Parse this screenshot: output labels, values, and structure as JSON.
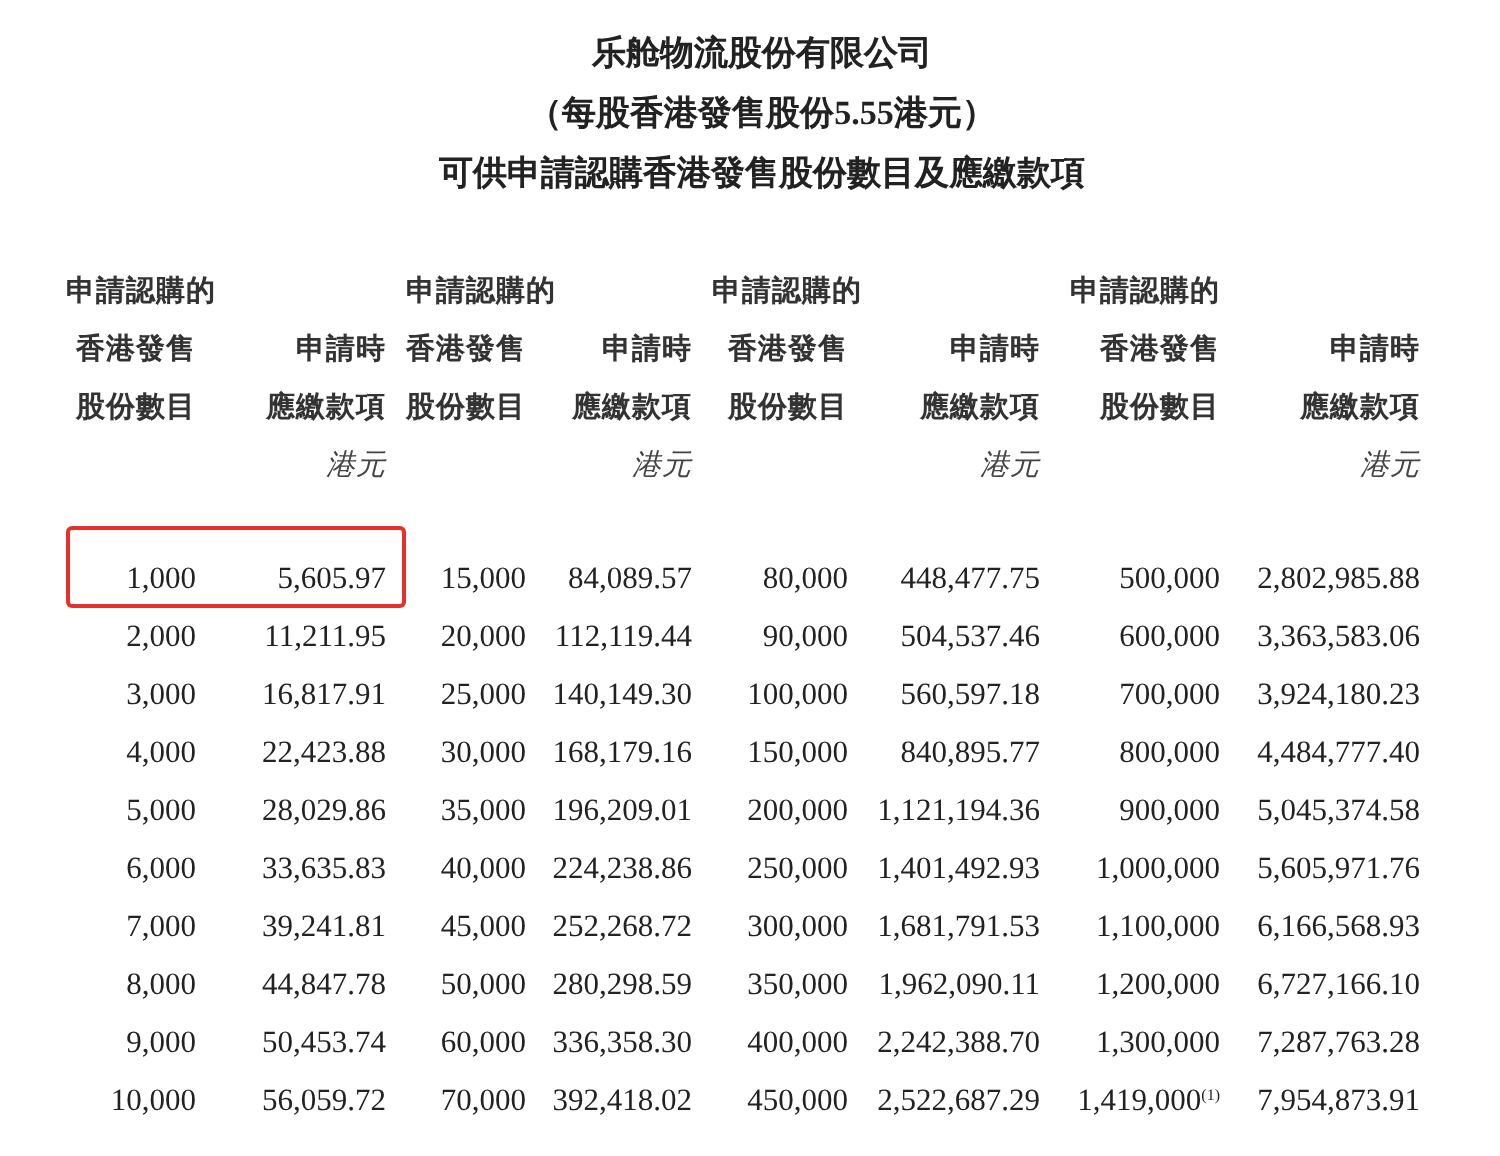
{
  "title_lines": [
    "乐舱物流股份有限公司",
    "（每股香港發售股份**5.55**港元）",
    "可供申請認購香港發售股份數目及應繳款項"
  ],
  "column_groups": [
    {
      "shares_header": [
        "申請認購的",
        "香港發售",
        "股份數目"
      ],
      "amount_header": [
        "申請時",
        "應繳款項"
      ],
      "unit": "港元"
    },
    {
      "shares_header": [
        "申請認購的",
        "香港發售",
        "股份數目"
      ],
      "amount_header": [
        "申請時",
        "應繳款項"
      ],
      "unit": "港元"
    },
    {
      "shares_header": [
        "申請認購的",
        "香港發售",
        "股份數目"
      ],
      "amount_header": [
        "申請時",
        "應繳款項"
      ],
      "unit": "港元"
    },
    {
      "shares_header": [
        "申請認購的",
        "香港發售",
        "股份數目"
      ],
      "amount_header": [
        "申請時",
        "應繳款項"
      ],
      "unit": "港元"
    }
  ],
  "rows": [
    {
      "pairs": [
        {
          "shares": "1,000",
          "amount": "5,605.97",
          "highlighted": true
        },
        {
          "shares": "15,000",
          "amount": "84,089.57",
          "highlighted": false
        },
        {
          "shares": "80,000",
          "amount": "448,477.75",
          "highlighted": false
        },
        {
          "shares": "500,000",
          "amount": "2,802,985.88",
          "highlighted": false
        }
      ]
    },
    {
      "pairs": [
        {
          "shares": "2,000",
          "amount": "11,211.95",
          "highlighted": false
        },
        {
          "shares": "20,000",
          "amount": "112,119.44",
          "highlighted": false
        },
        {
          "shares": "90,000",
          "amount": "504,537.46",
          "highlighted": false
        },
        {
          "shares": "600,000",
          "amount": "3,363,583.06",
          "highlighted": false
        }
      ]
    },
    {
      "pairs": [
        {
          "shares": "3,000",
          "amount": "16,817.91",
          "highlighted": false
        },
        {
          "shares": "25,000",
          "amount": "140,149.30",
          "highlighted": false
        },
        {
          "shares": "100,000",
          "amount": "560,597.18",
          "highlighted": false
        },
        {
          "shares": "700,000",
          "amount": "3,924,180.23",
          "highlighted": false
        }
      ]
    },
    {
      "pairs": [
        {
          "shares": "4,000",
          "amount": "22,423.88",
          "highlighted": false
        },
        {
          "shares": "30,000",
          "amount": "168,179.16",
          "highlighted": false
        },
        {
          "shares": "150,000",
          "amount": "840,895.77",
          "highlighted": false
        },
        {
          "shares": "800,000",
          "amount": "4,484,777.40",
          "highlighted": false
        }
      ]
    },
    {
      "pairs": [
        {
          "shares": "5,000",
          "amount": "28,029.86",
          "highlighted": false
        },
        {
          "shares": "35,000",
          "amount": "196,209.01",
          "highlighted": false
        },
        {
          "shares": "200,000",
          "amount": "1,121,194.36",
          "highlighted": false
        },
        {
          "shares": "900,000",
          "amount": "5,045,374.58",
          "highlighted": false
        }
      ]
    },
    {
      "pairs": [
        {
          "shares": "6,000",
          "amount": "33,635.83",
          "highlighted": false
        },
        {
          "shares": "40,000",
          "amount": "224,238.86",
          "highlighted": false
        },
        {
          "shares": "250,000",
          "amount": "1,401,492.93",
          "highlighted": false
        },
        {
          "shares": "1,000,000",
          "amount": "5,605,971.76",
          "highlighted": false
        }
      ]
    },
    {
      "pairs": [
        {
          "shares": "7,000",
          "amount": "39,241.81",
          "highlighted": false
        },
        {
          "shares": "45,000",
          "amount": "252,268.72",
          "highlighted": false
        },
        {
          "shares": "300,000",
          "amount": "1,681,791.53",
          "highlighted": false
        },
        {
          "shares": "1,100,000",
          "amount": "6,166,568.93",
          "highlighted": false
        }
      ]
    },
    {
      "pairs": [
        {
          "shares": "8,000",
          "amount": "44,847.78",
          "highlighted": false
        },
        {
          "shares": "50,000",
          "amount": "280,298.59",
          "highlighted": false
        },
        {
          "shares": "350,000",
          "amount": "1,962,090.11",
          "highlighted": false
        },
        {
          "shares": "1,200,000",
          "amount": "6,727,166.10",
          "highlighted": false
        }
      ]
    },
    {
      "pairs": [
        {
          "shares": "9,000",
          "amount": "50,453.74",
          "highlighted": false
        },
        {
          "shares": "60,000",
          "amount": "336,358.30",
          "highlighted": false
        },
        {
          "shares": "400,000",
          "amount": "2,242,388.70",
          "highlighted": false
        },
        {
          "shares": "1,300,000",
          "amount": "7,287,763.28",
          "highlighted": false
        }
      ]
    },
    {
      "pairs": [
        {
          "shares": "10,000",
          "amount": "56,059.72",
          "highlighted": false
        },
        {
          "shares": "70,000",
          "amount": "392,418.02",
          "highlighted": false
        },
        {
          "shares": "450,000",
          "amount": "2,522,687.29",
          "highlighted": false
        },
        {
          "shares": "1,419,000$^{(1)}$",
          "amount": "7,954,873.91",
          "highlighted": false
        }
      ]
    }
  ]
}
